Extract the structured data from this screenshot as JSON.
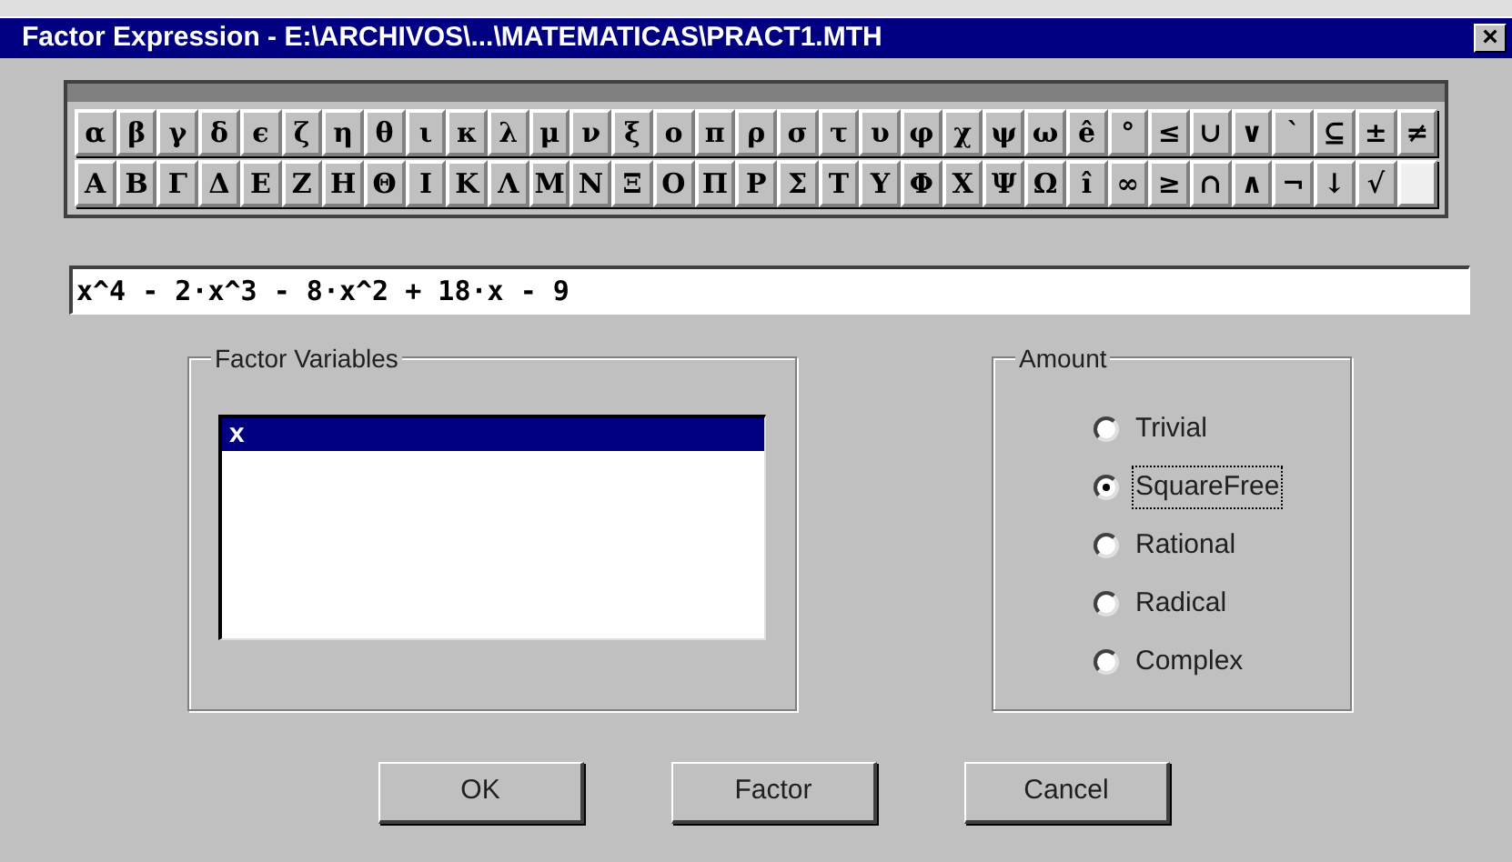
{
  "window": {
    "title": "Factor Expression - E:\\ARCHIVOS\\...\\MATEMATICAS\\PRACT1.MTH",
    "close": "×"
  },
  "symbol_rows": [
    {
      "keys": [
        {
          "label": "α"
        },
        {
          "label": "β"
        },
        {
          "label": "γ"
        },
        {
          "label": "δ"
        },
        {
          "label": "ϵ"
        },
        {
          "label": "ζ"
        },
        {
          "label": "η"
        },
        {
          "label": "θ"
        },
        {
          "label": "ι"
        },
        {
          "label": "κ"
        },
        {
          "label": "λ"
        },
        {
          "label": "μ"
        },
        {
          "label": "ν"
        },
        {
          "label": "ξ"
        },
        {
          "label": "ο"
        },
        {
          "label": "π"
        },
        {
          "label": "ρ"
        },
        {
          "label": "σ"
        },
        {
          "label": "τ"
        },
        {
          "label": "υ"
        },
        {
          "label": "φ"
        },
        {
          "label": "χ"
        },
        {
          "label": "ψ"
        },
        {
          "label": "ω"
        },
        {
          "label": "ê"
        },
        {
          "label": "°"
        },
        {
          "label": "≤"
        },
        {
          "label": "∪"
        },
        {
          "label": "∨"
        },
        {
          "label": "`"
        },
        {
          "label": "⊆"
        },
        {
          "label": "±"
        },
        {
          "label": "≠"
        }
      ]
    },
    {
      "keys": [
        {
          "label": "Α"
        },
        {
          "label": "Β"
        },
        {
          "label": "Γ"
        },
        {
          "label": "Δ"
        },
        {
          "label": "Ε"
        },
        {
          "label": "Ζ"
        },
        {
          "label": "Η"
        },
        {
          "label": "Θ"
        },
        {
          "label": "Ι"
        },
        {
          "label": "Κ"
        },
        {
          "label": "Λ"
        },
        {
          "label": "Μ"
        },
        {
          "label": "Ν"
        },
        {
          "label": "Ξ"
        },
        {
          "label": "Ο"
        },
        {
          "label": "Π"
        },
        {
          "label": "Ρ"
        },
        {
          "label": "Σ"
        },
        {
          "label": "Τ"
        },
        {
          "label": "Υ"
        },
        {
          "label": "Φ"
        },
        {
          "label": "Χ"
        },
        {
          "label": "Ψ"
        },
        {
          "label": "Ω"
        },
        {
          "label": "î"
        },
        {
          "label": "∞"
        },
        {
          "label": "≥"
        },
        {
          "label": "∩"
        },
        {
          "label": "∧"
        },
        {
          "label": "¬"
        },
        {
          "label": "↓"
        },
        {
          "label": "√"
        },
        {
          "kind": "blank"
        }
      ]
    }
  ],
  "expression": {
    "value": "x^4 - 2·x^3 - 8·x^2 + 18·x - 9"
  },
  "factor_variables": {
    "label": "Factor Variables",
    "items": [
      {
        "label": "x",
        "selected": true
      }
    ]
  },
  "amount": {
    "label": "Amount",
    "options": [
      {
        "label": "Trivial",
        "selected": false
      },
      {
        "label": "SquareFree",
        "selected": true
      },
      {
        "label": "Rational",
        "selected": false
      },
      {
        "label": "Radical",
        "selected": false
      },
      {
        "label": "Complex",
        "selected": false
      }
    ]
  },
  "buttons": [
    {
      "label": "OK"
    },
    {
      "label": "Factor"
    },
    {
      "label": "Cancel"
    }
  ]
}
